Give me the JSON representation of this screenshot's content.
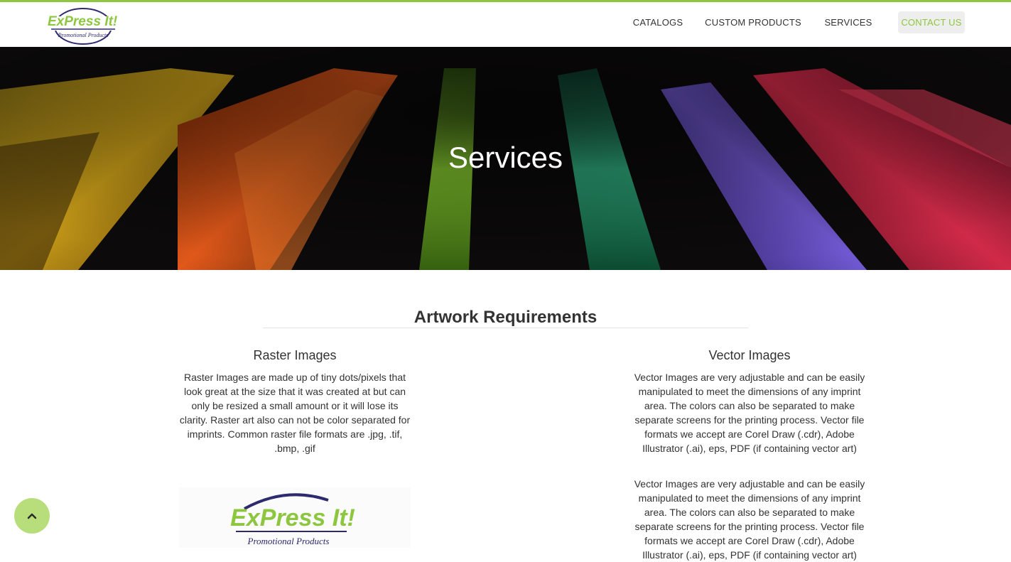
{
  "brand": {
    "name": "ExPress It!",
    "tagline": "Promotional Products",
    "accent_color": "#8dc63f",
    "navy_color": "#2e2a6e"
  },
  "nav": {
    "items": [
      {
        "label": "CATALOGS"
      },
      {
        "label": "CUSTOM PRODUCTS"
      },
      {
        "label": "SERVICES"
      },
      {
        "label": "CONTACT US",
        "active": true
      }
    ]
  },
  "hero": {
    "title": "Services"
  },
  "content": {
    "section_title": "Artwork Requirements",
    "raster": {
      "title": "Raster Images",
      "text": "Raster Images are made up of tiny dots/pixels that look great at the size that it was created at but can only be resized a small amount or it will lose its clarity. Raster art also can not be color separated for imprints. Common raster file formats are .jpg, .tif, .bmp, .gif"
    },
    "vector": {
      "title": "Vector Images",
      "text": "Vector Images are very adjustable and can be easily manipulated to meet the dimensions of any imprint area. The colors can also be separated to make separate screens for the printing process. Vector file formats we accept are Corel Draw (.cdr), Adobe Illustrator (.ai), eps, PDF (if containing vector art)",
      "text_repeat": "Vector Images are very adjustable and can be easily manipulated to meet the dimensions of any imprint area. The colors can also be separated to make separate screens for the printing process. Vector file formats we accept are Corel Draw (.cdr), Adobe Illustrator (.ai), eps, PDF (if containing vector art)"
    }
  },
  "scroll_top": {
    "icon": "chevron-up-icon",
    "color": "#b8de7c"
  }
}
